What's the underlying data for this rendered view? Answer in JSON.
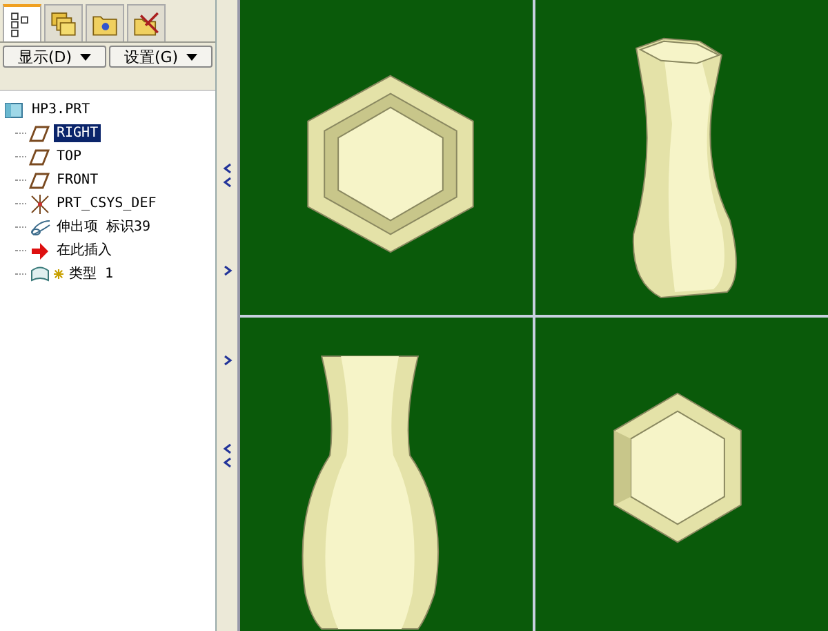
{
  "tabs": [
    {
      "kind": "tree",
      "selected": true
    },
    {
      "kind": "layers",
      "selected": false
    },
    {
      "kind": "folder",
      "selected": false
    },
    {
      "kind": "tools",
      "selected": false
    }
  ],
  "menus": [
    {
      "label": "显示(D)"
    },
    {
      "label": "设置(G)"
    }
  ],
  "tree": {
    "label": "HP3.PRT",
    "children": [
      {
        "label": "RIGHT",
        "kind": "plane",
        "selected": true
      },
      {
        "label": "TOP",
        "kind": "plane",
        "selected": false
      },
      {
        "label": "FRONT",
        "kind": "plane",
        "selected": false
      },
      {
        "label": "PRT_CSYS_DEF",
        "kind": "csys",
        "selected": false
      },
      {
        "label": "伸出项 标识39",
        "kind": "extrude",
        "selected": false
      },
      {
        "label": "在此插入",
        "kind": "insert",
        "selected": false
      },
      {
        "label": "类型 1",
        "kind": "sketch",
        "selected": false
      }
    ]
  },
  "viewports": [
    {
      "kind": "hex-top"
    },
    {
      "kind": "vase-3d"
    },
    {
      "kind": "vase-side"
    },
    {
      "kind": "hex-bottom"
    }
  ]
}
